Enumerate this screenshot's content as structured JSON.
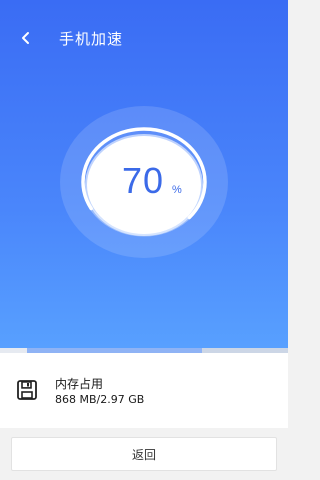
{
  "header": {
    "title": "手机加速",
    "back_icon": "chevron-left-icon"
  },
  "gauge": {
    "value": "70",
    "unit": "%",
    "percent": 70,
    "colors": {
      "ring": "#ffffff",
      "text": "#3b6ae8"
    }
  },
  "progress": {
    "fraction": 0.7
  },
  "memory": {
    "icon": "save-icon",
    "label": "内存占用",
    "value": "868 MB/2.97 GB"
  },
  "footer": {
    "back_label": "返回"
  },
  "colors": {
    "hero_top": "#3a6cf4",
    "hero_bottom": "#58a0ff",
    "accent": "#3b6ae8"
  }
}
